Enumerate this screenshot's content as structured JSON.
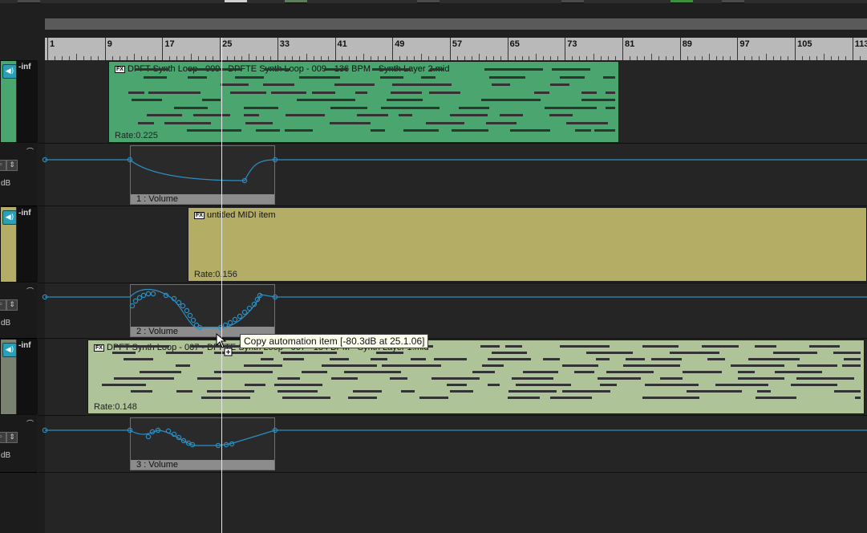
{
  "ruler": {
    "labels": [
      "1",
      "9",
      "17",
      "25",
      "33",
      "41",
      "49",
      "57",
      "65",
      "73",
      "81",
      "89",
      "97",
      "105",
      "113"
    ]
  },
  "tracks": [
    {
      "meter_label": "-inf",
      "color": "#4ba56e"
    },
    {
      "meter_label": "-inf",
      "color": "#b3ad66"
    },
    {
      "meter_label": "-inf",
      "color": "#7a8370"
    }
  ],
  "envelope_lanes": [
    {
      "db_label": "dB"
    },
    {
      "db_label": "dB"
    },
    {
      "db_label": "dB"
    }
  ],
  "items": [
    {
      "fx": "FX",
      "title": "DPFT Synth Loop - 009 - DPFTE Synth Loop - 009 - 136 BPM - Synth Layer 2.mid",
      "rate": "Rate:0.225",
      "color": "#4ba56e"
    },
    {
      "fx": "FX",
      "title": "untitled MIDI item",
      "rate": "Rate:0.156",
      "color": "#b3ad66"
    },
    {
      "fx": "FX",
      "title": "DPFT Synth Loop - 007 - DPFTE Synth Loop - 007 - 134 BPM - Synth Layer 1.mid",
      "rate": "Rate:0.148",
      "color": "#aec397"
    }
  ],
  "automation_items": [
    {
      "label": "1 : Volume"
    },
    {
      "label": "2 : Volume"
    },
    {
      "label": "3 : Volume"
    }
  ],
  "tooltip": {
    "text": "Copy automation item [-80.3dB at 25.1.06]"
  },
  "envelope_color": "#2b8fc4"
}
